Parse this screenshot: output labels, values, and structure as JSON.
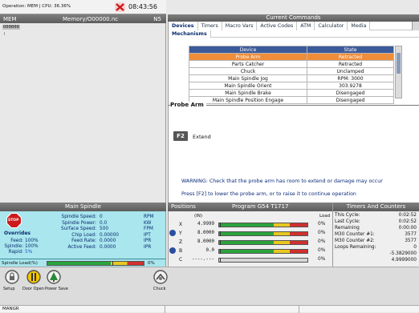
{
  "top_bar": {
    "operation": "Operation: MEM | CPU: 36.36%",
    "time": "08:43:56"
  },
  "program_panel": {
    "mode": "MEM",
    "path": "Memory/O00000.nc",
    "line_indicator": "N5",
    "program_number": "O00000",
    "cursor": ";"
  },
  "current_commands": {
    "title": "Current Commands",
    "tabs": [
      "Devices",
      "Timers",
      "Macro Vars",
      "Active Codes",
      "ATM",
      "Calculator",
      "Media"
    ],
    "active_tab": "Devices",
    "subtabs": [
      "Mechanisms"
    ],
    "table_headers": [
      "Device",
      "State"
    ],
    "devices": [
      {
        "device": "Probe Arm",
        "state": "Retracted",
        "selected": true
      },
      {
        "device": "Parts Catcher",
        "state": "Retracted",
        "selected": false
      },
      {
        "device": "Chuck",
        "state": "Unclamped",
        "selected": false
      },
      {
        "device": "Main Spindle Jog",
        "state": "RPM: 3000",
        "selected": false
      },
      {
        "device": "Main Spindle Orient",
        "state": "303.9278",
        "selected": false
      },
      {
        "device": "Main Spindle Brake",
        "state": "Disengaged",
        "selected": false
      },
      {
        "device": "Main Spindle Position Engage",
        "state": "Disengaged",
        "selected": false
      }
    ],
    "section_title": "Probe Arm",
    "key": "F2",
    "key_action": "Extend",
    "warning": "WARNING: Check that the probe arm has room to extend or damage may occur",
    "instruction": "Press [F2] to lower the probe arm, or to raise it to continue operation"
  },
  "main_spindle": {
    "title": "Main Spindle",
    "stop_label": "STOP",
    "overrides_label": "Overrides",
    "overrides": [
      {
        "label": "Feed:",
        "value": "100%"
      },
      {
        "label": "Spindle:",
        "value": "100%"
      },
      {
        "label": "Rapid:",
        "value": "5%"
      }
    ],
    "stats": [
      {
        "label": "Spindle Speed:",
        "value": "0",
        "unit": "RPM"
      },
      {
        "label": "Spindle Power:",
        "value": "0.0",
        "unit": "KW"
      },
      {
        "label": "Surface Speed:",
        "value": "500",
        "unit": "FPM"
      },
      {
        "label": "Chip Load:",
        "value": "0.00000",
        "unit": "IPT"
      },
      {
        "label": "Feed Rate:",
        "value": "0.0000",
        "unit": "IPR"
      },
      {
        "label": "Active Feed:",
        "value": "0.0000",
        "unit": "IPR"
      }
    ],
    "load_label": "Spindle Load(%)",
    "load_value": "0%",
    "load_fraction": 0.0
  },
  "positions": {
    "title": "Positions",
    "program": "Program G54 T1717",
    "units_header": "(IN)",
    "load_header": "Load",
    "axes": [
      {
        "axis": "X",
        "value": "4.9999",
        "load": "0%",
        "fraction": 0.0,
        "has_icon": false
      },
      {
        "axis": "Y",
        "value": "8.0000",
        "load": "0%",
        "fraction": 0.0,
        "has_icon": true
      },
      {
        "axis": "Z",
        "value": "8.0000",
        "load": "0%",
        "fraction": 0.0,
        "has_icon": false
      },
      {
        "axis": "B",
        "value": "0.0",
        "load": "0%",
        "fraction": 0.0,
        "has_icon": true
      },
      {
        "axis": "C",
        "value": "----.---",
        "load": "0%",
        "fraction": 0.0,
        "has_icon": false
      }
    ]
  },
  "timers": {
    "title": "Timers And Counters",
    "rows": [
      {
        "label": "This Cycle:",
        "value": "0:02:52"
      },
      {
        "label": "Last Cycle:",
        "value": "0:02:52"
      },
      {
        "label": "Remaining",
        "value": "0:00:00"
      },
      {
        "label": "M30 Counter #1:",
        "value": "3577"
      },
      {
        "label": "M30 Counter #2:",
        "value": "3577"
      },
      {
        "label": "Loops Remaining:",
        "value": "0"
      },
      {
        "label": "",
        "value": "-5.3829000"
      },
      {
        "label": "",
        "value": "4.9999000"
      }
    ]
  },
  "toolbar": {
    "items": [
      {
        "name": "setup",
        "label": "Setup"
      },
      {
        "name": "door-open",
        "label": "Door Open"
      },
      {
        "name": "power-save",
        "label": "Power Save"
      },
      {
        "name": "chuck",
        "label": "Chuck"
      }
    ]
  },
  "status": {
    "text": "MANGR"
  },
  "colors": {
    "header_gray": "#666666",
    "accent_orange": "#f08d3a",
    "spindle_bg": "#a9e6ee",
    "position_bg": "#efefef",
    "alarm_red": "#cc1a1a"
  }
}
